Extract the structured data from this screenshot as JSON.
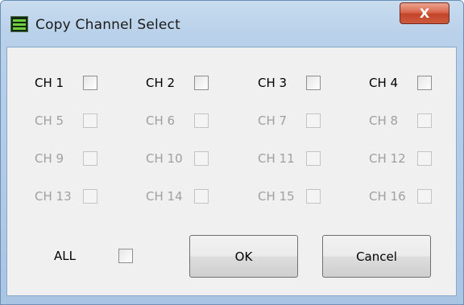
{
  "window": {
    "title": "Copy Channel Select",
    "close_label": "X"
  },
  "channels": [
    {
      "label": "CH 1",
      "enabled": true,
      "checked": false
    },
    {
      "label": "CH 2",
      "enabled": true,
      "checked": false
    },
    {
      "label": "CH 3",
      "enabled": true,
      "checked": false
    },
    {
      "label": "CH 4",
      "enabled": true,
      "checked": false
    },
    {
      "label": "CH 5",
      "enabled": false,
      "checked": false
    },
    {
      "label": "CH 6",
      "enabled": false,
      "checked": false
    },
    {
      "label": "CH 7",
      "enabled": false,
      "checked": false
    },
    {
      "label": "CH 8",
      "enabled": false,
      "checked": false
    },
    {
      "label": "CH 9",
      "enabled": false,
      "checked": false
    },
    {
      "label": "CH 10",
      "enabled": false,
      "checked": false
    },
    {
      "label": "CH 11",
      "enabled": false,
      "checked": false
    },
    {
      "label": "CH 12",
      "enabled": false,
      "checked": false
    },
    {
      "label": "CH 13",
      "enabled": false,
      "checked": false
    },
    {
      "label": "CH 14",
      "enabled": false,
      "checked": false
    },
    {
      "label": "CH 15",
      "enabled": false,
      "checked": false
    },
    {
      "label": "CH 16",
      "enabled": false,
      "checked": false
    }
  ],
  "all": {
    "label": "ALL",
    "checked": false
  },
  "buttons": {
    "ok": "OK",
    "cancel": "Cancel"
  },
  "icons": {
    "app": "app-icon",
    "close": "close-icon"
  }
}
